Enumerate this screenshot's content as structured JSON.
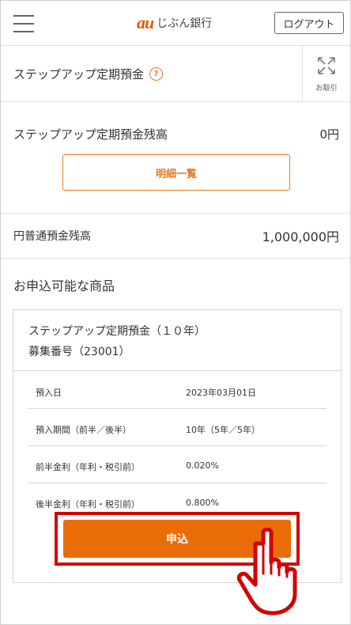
{
  "header": {
    "logo_mark": "au",
    "logo_text": "じぶん銀行",
    "logout_label": "ログアウト",
    "brand_color": "#eb5505"
  },
  "title_row": {
    "title": "ステップアップ定期預金",
    "help_icon": "?",
    "transaction_label": "お取引"
  },
  "balance": {
    "label": "ステップアップ定期預金残高",
    "value": "0円",
    "detail_button": "明細一覧"
  },
  "yen_balance": {
    "label": "円普通預金残高",
    "value": "1,000,000円"
  },
  "products": {
    "section_title": "お申込可能な商品",
    "card": {
      "name": "ステップアップ定期預金（１０年）",
      "recruit_no": "募集番号（23001）",
      "rows": [
        {
          "key": "預入日",
          "value": "2023年03月01日"
        },
        {
          "key": "預入期間（前半／後半）",
          "value": "10年（5年／5年）"
        },
        {
          "key": "前半金利（年利・税引前）",
          "value": "0.020%"
        },
        {
          "key": "後半金利（年利・税引前）",
          "value": "0.800%"
        }
      ],
      "apply_label": "申込",
      "apply_color": "#eb6d08",
      "highlight_color": "#d50000"
    }
  }
}
